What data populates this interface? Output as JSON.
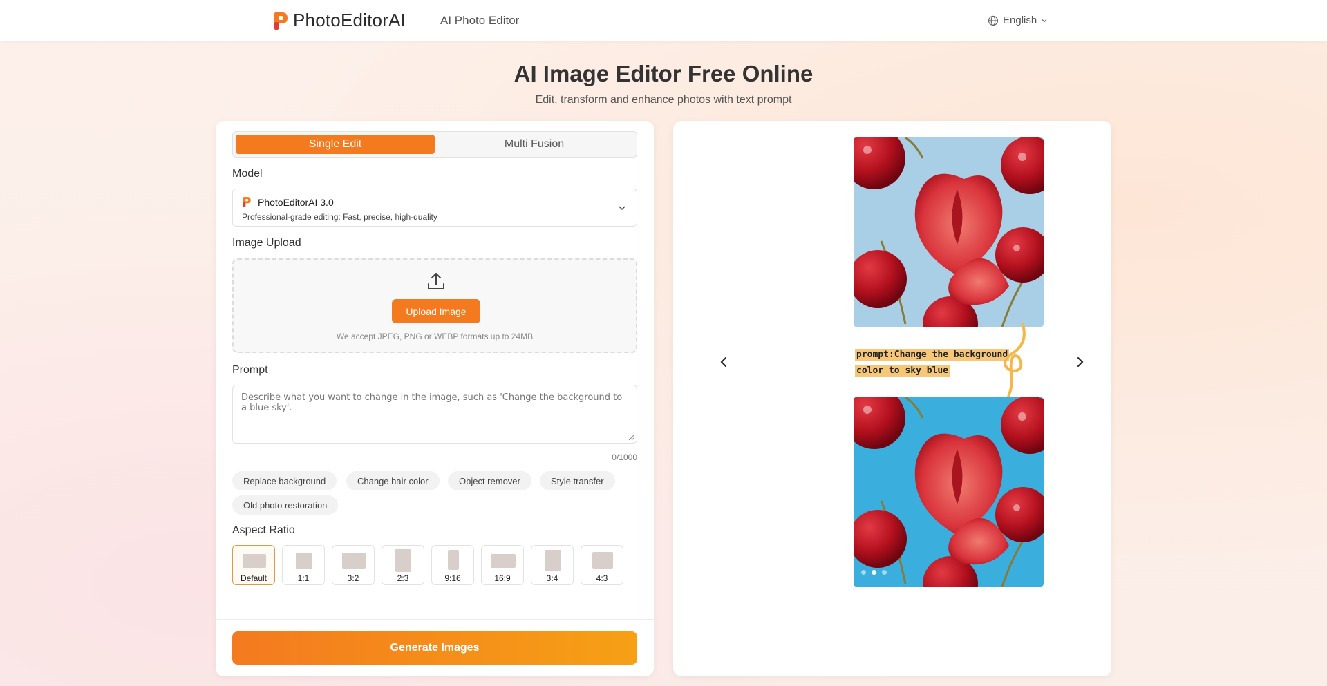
{
  "header": {
    "brand": "PhotoEditorAI",
    "nav_link": "AI Photo Editor",
    "language": "English"
  },
  "hero": {
    "title": "AI Image Editor Free Online",
    "subtitle": "Edit, transform and enhance photos with text prompt"
  },
  "editor": {
    "tabs": [
      {
        "label": "Single Edit",
        "active": true
      },
      {
        "label": "Multi Fusion",
        "active": false
      }
    ],
    "model_label": "Model",
    "model": {
      "name": "PhotoEditorAI 3.0",
      "description": "Professional-grade editing: Fast, precise, high-quality"
    },
    "upload_label": "Image Upload",
    "upload_button": "Upload Image",
    "upload_note": "We accept JPEG, PNG or WEBP formats up to 24MB",
    "prompt_label": "Prompt",
    "prompt_placeholder": "Describe what you want to change in the image, such as 'Change the background to a blue sky'.",
    "prompt_counter": "0/1000",
    "suggestions": [
      "Replace background",
      "Change hair color",
      "Object remover",
      "Style transfer",
      "Old photo restoration"
    ],
    "aspect_label": "Aspect Ratio",
    "aspect_ratios": [
      "Default",
      "1:1",
      "3:2",
      "2:3",
      "9:16",
      "16:9",
      "3:4",
      "4:3"
    ],
    "selected_aspect": "Default",
    "generate_button": "Generate Images"
  },
  "preview": {
    "prompt_line1": "prompt:Change the background",
    "prompt_line2": "color to sky blue",
    "slides": 3,
    "active_slide": 2
  },
  "colors": {
    "accent": "#f47a1f",
    "accent_end": "#f6a015",
    "sky_before": "#a9cfe6",
    "sky_after": "#3aaedd"
  },
  "icons": [
    "logo-icon",
    "globe-icon",
    "chevron-down-icon",
    "upload-icon",
    "chevron-left-icon",
    "chevron-right-icon",
    "resize-grip-icon"
  ]
}
